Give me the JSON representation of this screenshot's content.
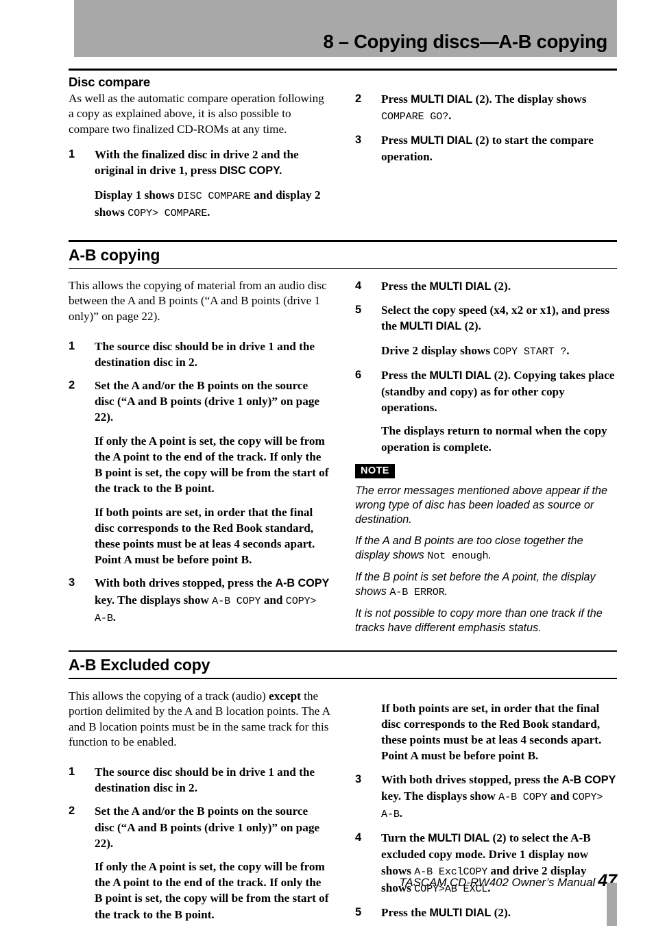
{
  "header": {
    "title": "8 – Copying discs—A-B copying",
    "band_color": "#a8a8a8"
  },
  "sections": [
    {
      "id": "disc-compare",
      "heading": "Disc compare",
      "left": {
        "intro": "As well as the automatic compare operation following a copy as explained above, it is also possible to compare two finalized CD-ROMs at any time.",
        "step1_num": "1",
        "step1_a": "With the finalized disc in drive 2 and the original in drive 1, press ",
        "step1_key": "DISC COPY.",
        "step1_b_1": "Display 1 shows ",
        "step1_b_disp1": "DISC COMPARE",
        "step1_b_2": " and display 2 shows ",
        "step1_b_disp2": "COPY> COMPARE",
        "step1_b_3": "."
      },
      "right": {
        "step2_num": "2",
        "step2_a": "Press ",
        "step2_key": "MULTI DIAL",
        "step2_b": " (2). The display shows ",
        "step2_disp": "COMPARE GO?",
        "step2_c": ".",
        "step3_num": "3",
        "step3_a": "Press ",
        "step3_key": "MULTI DIAL",
        "step3_b": " (2) to start the compare operation."
      }
    },
    {
      "id": "ab-copying",
      "heading": "A-B copying",
      "left": {
        "intro": "This allows the copying of material from an audio disc between the A and B points (“A and B points (drive 1 only)” on page 22).",
        "step1_num": "1",
        "step1": "The source disc should be in drive 1 and the destination disc in 2.",
        "step2_num": "2",
        "step2": "Set the A and/or the B points on the source disc (“A and B points (drive 1 only)” on page 22).",
        "step2_note_a": "If only the A point is set, the copy will be from the A point to the end of the track. If only the B point is set, the copy will be from the start of the track to the B point.",
        "step2_note_b": "If both points are set, in order that the final disc corresponds to the Red Book standard, these points must be at leas 4 seconds apart. Point A must be before point B.",
        "step3_num": "3",
        "step3_a": "With both drives stopped, press the ",
        "step3_key": "A-B COPY",
        "step3_b": " key. The displays show ",
        "step3_disp1": "A-B  COPY",
        "step3_c": " and ",
        "step3_disp2": "COPY>  A-B",
        "step3_d": "."
      },
      "right": {
        "step4_num": "4",
        "step4_a": "Press the ",
        "step4_key": "MULTI DIAL",
        "step4_b": " (2).",
        "step5_num": "5",
        "step5_a": "Select the copy speed (x4, x2 or x1), and press the ",
        "step5_key": "MULTI DIAL",
        "step5_b": " (2).",
        "step5_note_a": "Drive 2 display shows ",
        "step5_note_disp": "COPY START ?",
        "step5_note_b": ".",
        "step6_num": "6",
        "step6_a": "Press the ",
        "step6_key": "MULTI DIAL",
        "step6_b": " (2). Copying takes place (standby and copy) as for other copy operations.",
        "step6_note": "The displays return to normal when the copy operation is complete.",
        "note_badge": "NOTE",
        "note_p1": "The error messages mentioned above appear if the wrong type of disc has been loaded as source or destination.",
        "note_p2_a": "If the A and B points are too close together the display shows ",
        "note_p2_disp": "Not enough",
        "note_p2_b": ".",
        "note_p3_a": "If the B point is set before the A point, the display shows ",
        "note_p3_disp": "A-B ERROR",
        "note_p3_b": ".",
        "note_p4": "It is not possible to copy more than one track if the tracks have different emphasis status."
      }
    },
    {
      "id": "ab-excluded-copy",
      "heading": "A-B Excluded copy",
      "left": {
        "intro_a": "This allows the copying of a track (audio) ",
        "intro_bold": "except",
        "intro_b": " the portion delimited by the A and B location points. The A and B location points must be in the same track for this function to be enabled.",
        "step1_num": "1",
        "step1": "The source disc should be in drive 1 and the destination disc in 2.",
        "step2_num": "2",
        "step2": "Set the A and/or the B points on the source disc (“A and B points (drive 1 only)” on page 22).",
        "step2_note": "If only the A point is set, the copy will be from the A point to the end of the track. If only the B point is set, the copy will be from the start of the track to the B point."
      },
      "right": {
        "note_both": "If both points are set, in order that the final disc corresponds to the Red Book standard, these points must be at leas 4 seconds apart. Point A must be before point B.",
        "step3_num": "3",
        "step3_a": "With both drives stopped, press the ",
        "step3_key": "A-B COPY",
        "step3_b": " key. The displays show ",
        "step3_disp1": "A-B  COPY",
        "step3_c": " and ",
        "step3_disp2": "COPY>  A-B",
        "step3_d": ".",
        "step4_num": "4",
        "step4_a": "Turn the ",
        "step4_key": "MULTI DIAL",
        "step4_b": " (2) to select the A-B excluded copy mode. Drive 1 display now shows ",
        "step4_disp1": "A-B ExclCOPY",
        "step4_c": " and drive 2 display shows ",
        "step4_disp2": "COPY>AB EXCL",
        "step4_d": ".",
        "step5_num": "5",
        "step5_a": "Press the ",
        "step5_key": "MULTI DIAL",
        "step5_b": " (2)."
      }
    }
  ],
  "footer": {
    "text": "TASCAM CD-RW402 Owner’s Manual",
    "page": "47"
  }
}
